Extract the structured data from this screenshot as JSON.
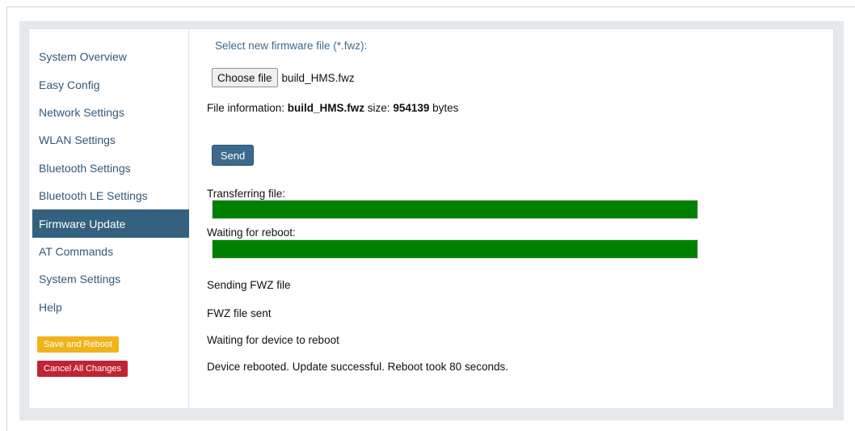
{
  "sidebar": {
    "items": [
      {
        "label": "System Overview"
      },
      {
        "label": "Easy Config"
      },
      {
        "label": "Network Settings"
      },
      {
        "label": "WLAN Settings"
      },
      {
        "label": "Bluetooth Settings"
      },
      {
        "label": "Bluetooth LE Settings"
      },
      {
        "label": "Firmware Update"
      },
      {
        "label": "AT Commands"
      },
      {
        "label": "System Settings"
      },
      {
        "label": "Help"
      }
    ],
    "active": "Firmware Update",
    "save_label": "Save and Reboot",
    "cancel_label": "Cancel All Changes"
  },
  "firmware": {
    "heading": "Select new firmware file (*.fwz):",
    "choose_label": "Choose file",
    "file_name": "build_HMS.fwz",
    "info_prefix": "File information: ",
    "info_file": "build_HMS.fwz",
    "info_size_label": " size: ",
    "info_size": "954139",
    "info_suffix": " bytes",
    "send_label": "Send",
    "transfer_label": "Transferring file:",
    "transfer_progress": 100,
    "reboot_label": "Waiting for reboot:",
    "reboot_progress": 100,
    "status_messages": [
      "Sending FWZ file",
      "FWZ file sent",
      "Waiting for device to reboot",
      "Device rebooted. Update successful. Reboot took 80 seconds."
    ]
  },
  "colors": {
    "accent": "#33617f",
    "progress": "#008000",
    "save": "#f0b31a",
    "cancel": "#c02434"
  }
}
